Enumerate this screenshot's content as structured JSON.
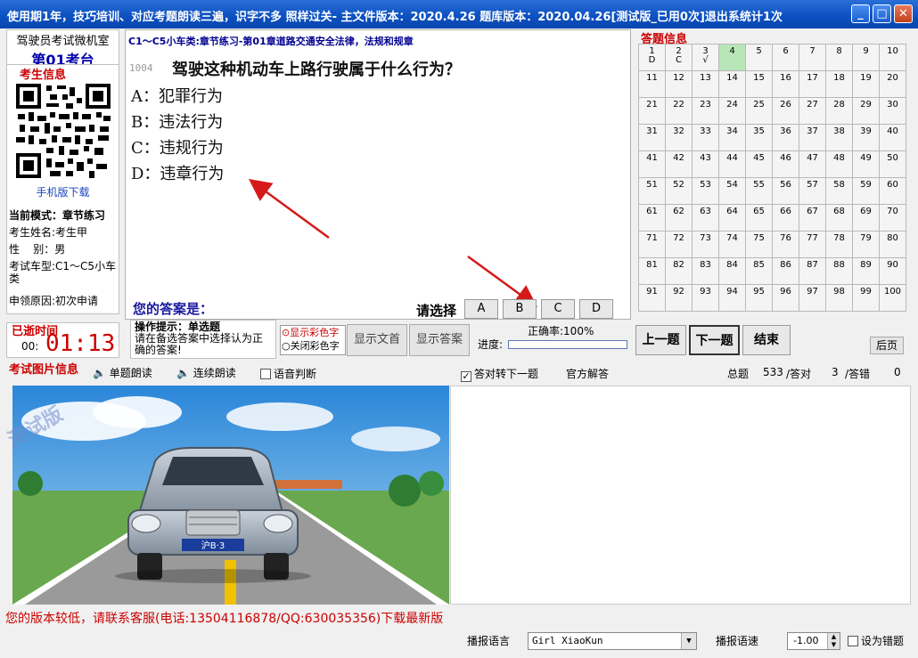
{
  "window": {
    "title": "使用期1年，技巧培训、对应考题朗读三遍，识字不多 照样过关- 主文件版本：2020.4.26  题库版本：2020.04.26[测试版_已用0次]退出系统计1次"
  },
  "left": {
    "school_name": "驾驶员考试微机室",
    "room": "第01考台",
    "examinee_header": "考生信息",
    "mobile_download": "手机版下载",
    "mode": "当前模式：章节练习",
    "name": "考生姓名:考生甲",
    "gender": "性    别：男",
    "car_type": "考试车型:C1～C5小车类",
    "apply_reason": "申领原因:初次申请",
    "elapsed_label": "已逝时间",
    "hours": "00:",
    "min_sec": "01:13"
  },
  "question": {
    "chapter": "C1～C5小车类:章节练习-第01章道路交通安全法律，法规和规章",
    "number": "1004",
    "text": "驾驶这种机动车上路行驶属于什么行为？",
    "options": [
      "A：犯罪行为",
      "B：违法行为",
      "C：违规行为",
      "D：违章行为"
    ],
    "your_answer_label": "您的答案是：",
    "select_label": "请选择",
    "choices": [
      "A",
      "B",
      "C",
      "D"
    ]
  },
  "answer_grid": {
    "header": "答题信息",
    "cells": [
      {
        "n": "1",
        "a": "D"
      },
      {
        "n": "2",
        "a": "C"
      },
      {
        "n": "3",
        "a": "√"
      },
      {
        "n": "4",
        "a": ""
      },
      {
        "n": "5",
        "a": ""
      },
      {
        "n": "6",
        "a": ""
      },
      {
        "n": "7",
        "a": ""
      },
      {
        "n": "8",
        "a": ""
      },
      {
        "n": "9",
        "a": ""
      },
      {
        "n": "10",
        "a": ""
      },
      {
        "n": "11",
        "a": ""
      },
      {
        "n": "12",
        "a": ""
      },
      {
        "n": "13",
        "a": ""
      },
      {
        "n": "14",
        "a": ""
      },
      {
        "n": "15",
        "a": ""
      },
      {
        "n": "16",
        "a": ""
      },
      {
        "n": "17",
        "a": ""
      },
      {
        "n": "18",
        "a": ""
      },
      {
        "n": "19",
        "a": ""
      },
      {
        "n": "20",
        "a": ""
      },
      {
        "n": "21",
        "a": ""
      },
      {
        "n": "22",
        "a": ""
      },
      {
        "n": "23",
        "a": ""
      },
      {
        "n": "24",
        "a": ""
      },
      {
        "n": "25",
        "a": ""
      },
      {
        "n": "26",
        "a": ""
      },
      {
        "n": "27",
        "a": ""
      },
      {
        "n": "28",
        "a": ""
      },
      {
        "n": "29",
        "a": ""
      },
      {
        "n": "30",
        "a": ""
      },
      {
        "n": "31",
        "a": ""
      },
      {
        "n": "32",
        "a": ""
      },
      {
        "n": "33",
        "a": ""
      },
      {
        "n": "34",
        "a": ""
      },
      {
        "n": "35",
        "a": ""
      },
      {
        "n": "36",
        "a": ""
      },
      {
        "n": "37",
        "a": ""
      },
      {
        "n": "38",
        "a": ""
      },
      {
        "n": "39",
        "a": ""
      },
      {
        "n": "40",
        "a": ""
      },
      {
        "n": "41",
        "a": ""
      },
      {
        "n": "42",
        "a": ""
      },
      {
        "n": "43",
        "a": ""
      },
      {
        "n": "44",
        "a": ""
      },
      {
        "n": "45",
        "a": ""
      },
      {
        "n": "46",
        "a": ""
      },
      {
        "n": "47",
        "a": ""
      },
      {
        "n": "48",
        "a": ""
      },
      {
        "n": "49",
        "a": ""
      },
      {
        "n": "50",
        "a": ""
      },
      {
        "n": "51",
        "a": ""
      },
      {
        "n": "52",
        "a": ""
      },
      {
        "n": "53",
        "a": ""
      },
      {
        "n": "54",
        "a": ""
      },
      {
        "n": "55",
        "a": ""
      },
      {
        "n": "56",
        "a": ""
      },
      {
        "n": "57",
        "a": ""
      },
      {
        "n": "58",
        "a": ""
      },
      {
        "n": "59",
        "a": ""
      },
      {
        "n": "60",
        "a": ""
      },
      {
        "n": "61",
        "a": ""
      },
      {
        "n": "62",
        "a": ""
      },
      {
        "n": "63",
        "a": ""
      },
      {
        "n": "64",
        "a": ""
      },
      {
        "n": "65",
        "a": ""
      },
      {
        "n": "66",
        "a": ""
      },
      {
        "n": "67",
        "a": ""
      },
      {
        "n": "68",
        "a": ""
      },
      {
        "n": "69",
        "a": ""
      },
      {
        "n": "70",
        "a": ""
      },
      {
        "n": "71",
        "a": ""
      },
      {
        "n": "72",
        "a": ""
      },
      {
        "n": "73",
        "a": ""
      },
      {
        "n": "74",
        "a": ""
      },
      {
        "n": "75",
        "a": ""
      },
      {
        "n": "76",
        "a": ""
      },
      {
        "n": "77",
        "a": ""
      },
      {
        "n": "78",
        "a": ""
      },
      {
        "n": "79",
        "a": ""
      },
      {
        "n": "80",
        "a": ""
      },
      {
        "n": "81",
        "a": ""
      },
      {
        "n": "82",
        "a": ""
      },
      {
        "n": "83",
        "a": ""
      },
      {
        "n": "84",
        "a": ""
      },
      {
        "n": "85",
        "a": ""
      },
      {
        "n": "86",
        "a": ""
      },
      {
        "n": "87",
        "a": ""
      },
      {
        "n": "88",
        "a": ""
      },
      {
        "n": "89",
        "a": ""
      },
      {
        "n": "90",
        "a": ""
      },
      {
        "n": "91",
        "a": ""
      },
      {
        "n": "92",
        "a": ""
      },
      {
        "n": "93",
        "a": ""
      },
      {
        "n": "94",
        "a": ""
      },
      {
        "n": "95",
        "a": ""
      },
      {
        "n": "96",
        "a": ""
      },
      {
        "n": "97",
        "a": ""
      },
      {
        "n": "98",
        "a": ""
      },
      {
        "n": "99",
        "a": ""
      },
      {
        "n": "100",
        "a": ""
      }
    ],
    "current": "4"
  },
  "controls": {
    "op_tip_title": "操作提示：单选题",
    "op_tip_body": "请在备选答案中选择认为正确的答案!",
    "color_on": "⊙显示彩色字",
    "color_off": "○关闭彩色字",
    "show_text": "显示文首",
    "show_answer": "显示答案",
    "accuracy": "正确率:100%",
    "progress_label": "进度:",
    "prev": "上一题",
    "next": "下一题",
    "end": "结束",
    "back": "后页"
  },
  "picture_row": {
    "header": "考试图片信息",
    "read_single": "单题朗读",
    "read_continuous": "连续朗读",
    "voice_judge": "语音判断",
    "auto_next": "答对转下一题",
    "official": "官方解答",
    "total_label": "总题",
    "total": "533",
    "correct_label": "/答对",
    "correct": "3",
    "wrong_label": "/答错",
    "wrong": "0",
    "watermark": "测试版",
    "plate": "沪B·3"
  },
  "footer": {
    "message": "您的版本较低，请联系客服(电话:13504116878/QQ:630035356)下载最新版",
    "voice_label": "播报语言",
    "voice_value": "Girl XiaoKun",
    "speed_label": "播报语速",
    "speed_value": "-1.00",
    "set_wrong": "设为错题"
  },
  "colors": {
    "titlebar": "#0b4fc0",
    "accent_red": "#cc0000",
    "current_cell": "#b8e6b8"
  }
}
